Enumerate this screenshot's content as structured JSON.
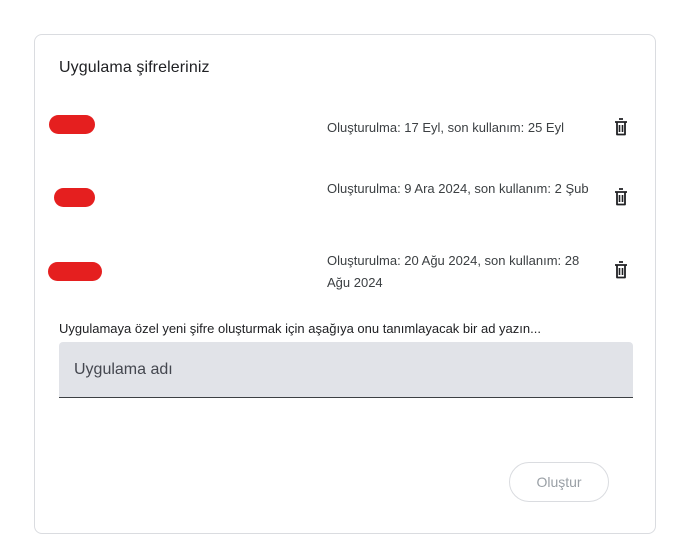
{
  "card": {
    "title": "Uygulama şifreleriniz"
  },
  "app_passwords": [
    {
      "meta": "Oluşturulma: 17 Eyl, son kullanım: 25 Eyl",
      "delete_icon": "trash-icon"
    },
    {
      "meta": "Oluşturulma: 9 Ara 2024, son kullanım: 2 Şub",
      "delete_icon": "trash-icon"
    },
    {
      "meta": "Oluşturulma: 20 Ağu 2024, son kullanım: 28 Ağu 2024",
      "delete_icon": "trash-icon"
    }
  ],
  "create_section": {
    "hint": "Uygulamaya özel yeni şifre oluşturmak için aşağıya onu tanımlayacak bir ad yazın...",
    "input_value": "",
    "input_placeholder": "Uygulama adı",
    "button_label": "Oluştur"
  },
  "colors": {
    "redaction": "#e51f1f",
    "field_bg": "#e1e3e8",
    "border": "#dadce0"
  }
}
